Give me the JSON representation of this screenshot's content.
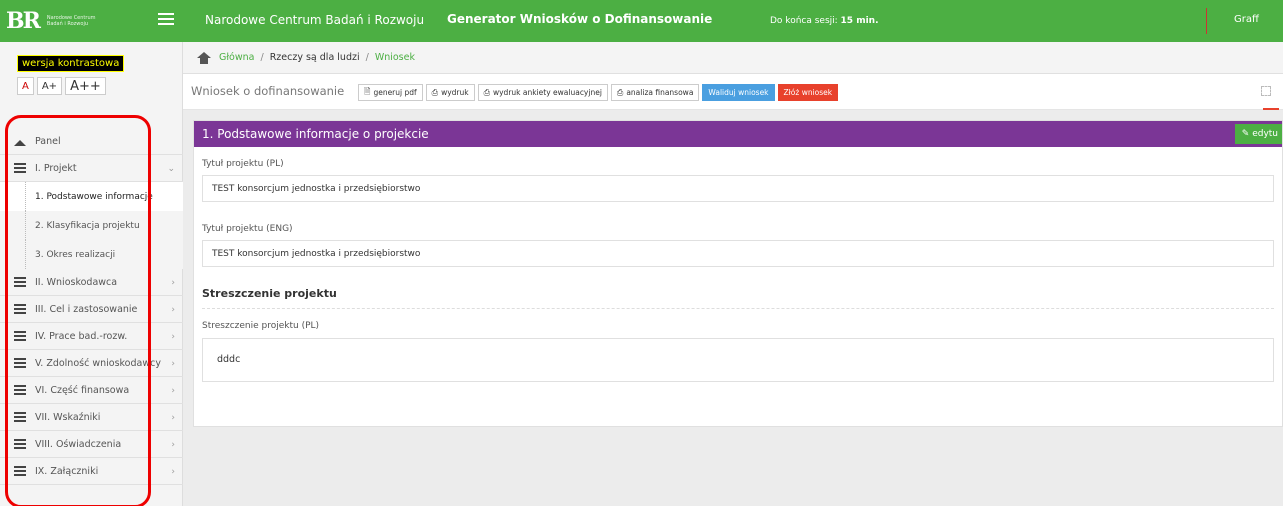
{
  "header": {
    "logo_mark": "BR",
    "logo_text": "Narodowe Centrum Badań i Rozwoju",
    "org": "Narodowe Centrum Badań i Rozwoju",
    "app": "Generator Wniosków o Dofinansowanie",
    "session_label": "Do końca sesji:",
    "session_value": "15 min.",
    "user": "Graff"
  },
  "sidebar": {
    "contrast": "wersja kontrastowa",
    "font_small": "A",
    "font_mid": "A+",
    "font_big": "A++",
    "panel": "Panel",
    "project": "I. Projekt",
    "sub_items": [
      "1. Podstawowe informacje",
      "2. Klasyfikacja projektu",
      "3. Okres realizacji"
    ],
    "items": [
      "II. Wnioskodawca",
      "III. Cel i zastosowanie",
      "IV. Prace bad.-rozw.",
      "V. Zdolność wnioskodawcy",
      "VI. Część finansowa",
      "VII. Wskaźniki",
      "VIII. Oświadczenia",
      "IX. Załączniki"
    ]
  },
  "breadcrumb": {
    "home": "Główna",
    "level2": "Rzeczy są dla ludzi",
    "level3": "Wniosek"
  },
  "toolbar": {
    "title": "Wniosek o dofinansowanie",
    "pdf": "generuj pdf",
    "print": "wydruk",
    "print_survey": "wydruk ankiety ewaluacyjnej",
    "financial": "analiza finansowa",
    "validate": "Waliduj wniosek",
    "submit": "Złóż wniosek"
  },
  "panel": {
    "title": "1. Podstawowe informacje o projekcie",
    "edit": "edytu",
    "title_pl_label": "Tytuł projektu (PL)",
    "title_pl_value": "TEST konsorcjum jednostka i przedsiębiorstwo",
    "title_eng_label": "Tytuł projektu (ENG)",
    "title_eng_value": "TEST konsorcjum jednostka i przedsiębiorstwo",
    "summary_section": "Streszczenie projektu",
    "summary_pl_label": "Streszczenie projektu (PL)",
    "summary_pl_value": "dddc"
  }
}
